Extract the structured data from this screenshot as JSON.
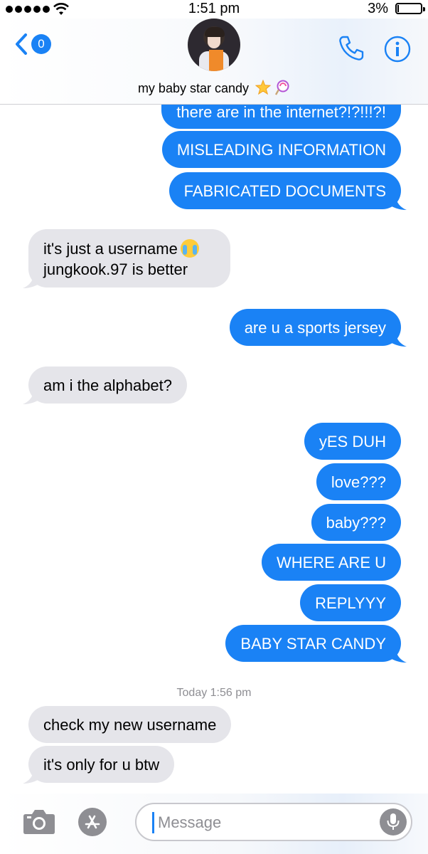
{
  "status_bar": {
    "time": "1:51 pm",
    "battery_percent": "3%",
    "battery_level": 0.03,
    "signal_bars": 5
  },
  "header": {
    "back_badge_count": "0",
    "contact_name": "my baby star candy",
    "contact_name_emojis": [
      "glowing-star-emoji",
      "lollipop-emoji"
    ],
    "accent_color": "#1a82f5"
  },
  "messages": [
    {
      "direction": "outgoing",
      "text": "there are in the internet?!?!!!?!"
    },
    {
      "direction": "outgoing",
      "text": "MISLEADING INFORMATION"
    },
    {
      "direction": "outgoing",
      "text": "FABRICATED DOCUMENTS"
    },
    {
      "direction": "incoming",
      "line1": "it's just a username",
      "line2": "jungkook.97 is better",
      "emoji": "loudly-crying-face-emoji"
    },
    {
      "direction": "outgoing",
      "text": "are u a sports jersey"
    },
    {
      "direction": "incoming",
      "text": "am i the alphabet?"
    },
    {
      "direction": "outgoing",
      "text": "yES DUH"
    },
    {
      "direction": "outgoing",
      "text": "love???"
    },
    {
      "direction": "outgoing",
      "text": "baby???"
    },
    {
      "direction": "outgoing",
      "text": "WHERE ARE U"
    },
    {
      "direction": "outgoing",
      "text": "REPLYYY"
    },
    {
      "direction": "outgoing",
      "text": "BABY STAR CANDY"
    },
    {
      "direction": "incoming",
      "text": "check my new username"
    },
    {
      "direction": "incoming",
      "text": "it's only for u btw"
    }
  ],
  "timestamp_divider": "Today 1:56 pm",
  "input_bar": {
    "placeholder": "Message",
    "icons": [
      "camera-icon",
      "app-store-icon",
      "microphone-icon"
    ]
  },
  "colors": {
    "outgoing_bubble": "#1a82f5",
    "incoming_bubble": "#e5e5ea",
    "timestamp_text": "#8e8e93"
  }
}
